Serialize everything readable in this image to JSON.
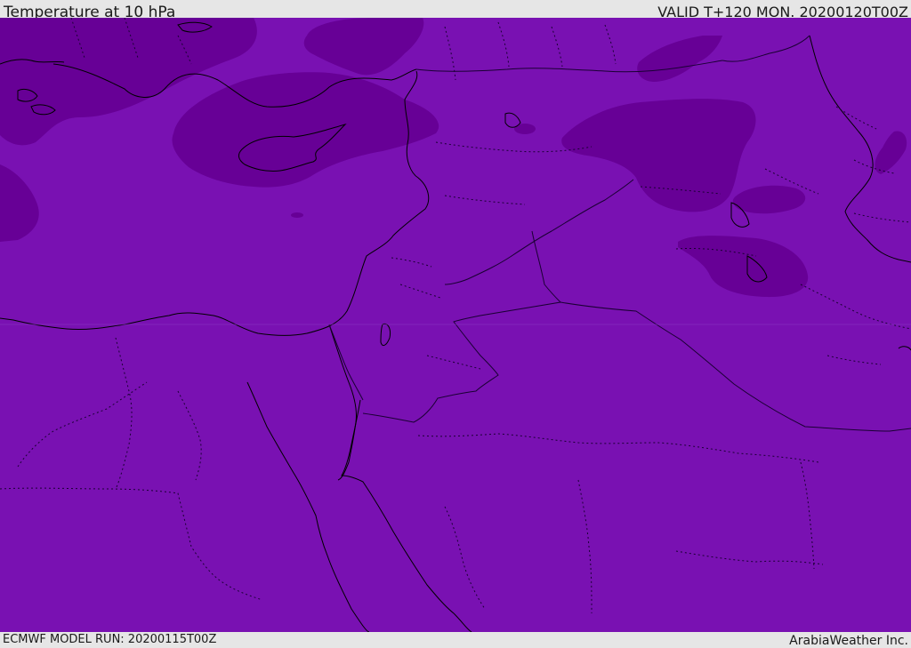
{
  "header": {
    "title": "Temperature at 10 hPa",
    "valid": "VALID T+120 MON. 20200120T00Z"
  },
  "footer": {
    "model_run": "ECMWF MODEL RUN: 20200115T00Z",
    "credit": "ArabiaWeather Inc."
  },
  "colors": {
    "base_field": "#7911b2",
    "cold_field": "#670096",
    "coast": "#000000",
    "border": "#1a0033"
  }
}
